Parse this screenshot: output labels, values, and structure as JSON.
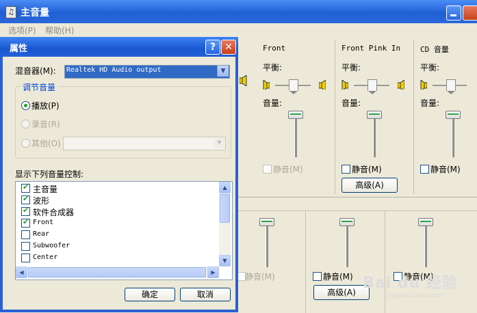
{
  "main_window": {
    "title": "主音量",
    "menu": [
      "选项(P)",
      "帮助(H)"
    ]
  },
  "columns": [
    {
      "title": "Front",
      "balance_label": "平衡:",
      "volume_label": "音量:",
      "mute_label": "静音(M)",
      "mute_enabled": false,
      "level": 0.85
    },
    {
      "title": "Front Pink In",
      "balance_label": "平衡:",
      "volume_label": "音量:",
      "mute_label": "静音(M)",
      "mute_enabled": true,
      "advanced_label": "高级(A)",
      "level": 0.85
    },
    {
      "title": "CD 音量",
      "balance_label": "平衡:",
      "volume_label": "音量:",
      "mute_label": "静音(M)",
      "mute_enabled": true,
      "level": 0.85
    }
  ],
  "lower_window": {
    "columns": [
      {
        "mute_label": "静音(M)",
        "mute_enabled": false,
        "level": 0.85
      },
      {
        "mute_label": "静音(M)",
        "mute_enabled": true,
        "advanced_label": "高级(A)",
        "level": 0.85
      },
      {
        "mute_label": "静音(M)",
        "mute_enabled": true,
        "level": 0.85
      }
    ]
  },
  "dialog": {
    "title": "属性",
    "help_glyph": "?",
    "close_glyph": "✕",
    "mixer_label": "混音器(M):",
    "mixer_value": "Realtek HD Audio output",
    "group_title": "调节音量",
    "radio_playback": "播放(P)",
    "radio_record": "录音(R)",
    "radio_other": "其他(O)",
    "list_label": "显示下列音量控制:",
    "list_items": [
      {
        "label": "主音量",
        "checked": true
      },
      {
        "label": "波形",
        "checked": true
      },
      {
        "label": "软件合成器",
        "checked": true
      },
      {
        "label": "Front",
        "checked": true
      },
      {
        "label": "Rear",
        "checked": false
      },
      {
        "label": "Subwoofer",
        "checked": false
      },
      {
        "label": "Center",
        "checked": false
      }
    ],
    "ok_label": "确定",
    "cancel_label": "取消"
  },
  "watermark": {
    "text": "Bai du 经验",
    "url": "jingyan.baidu.com"
  },
  "colors": {
    "titlebar": "#2361d8",
    "face": "#ece9d8",
    "check": "#21a121",
    "accent_text": "#0046d5"
  }
}
